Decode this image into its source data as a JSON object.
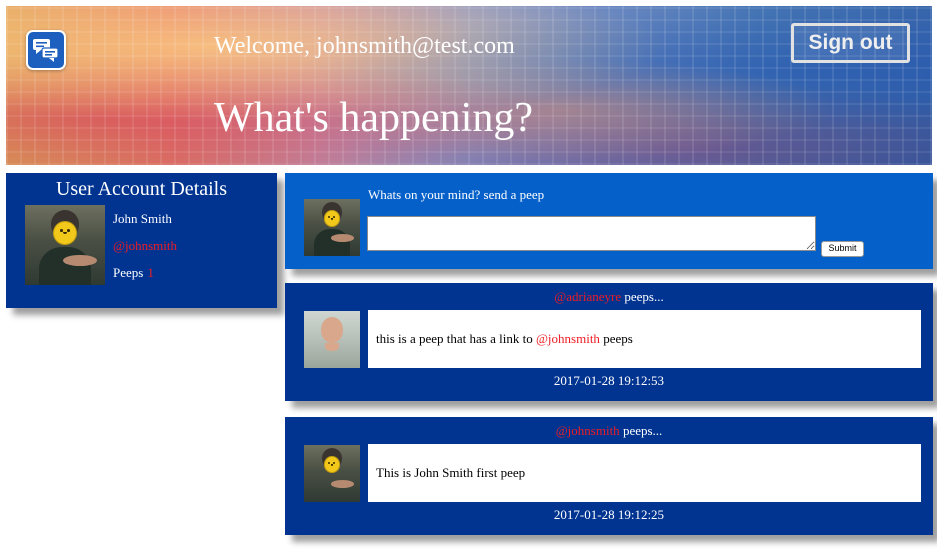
{
  "header": {
    "welcome": "Welcome, johnsmith@test.com",
    "headline": "What's happening?",
    "signout_label": "Sign out",
    "logo_icon": "chat-bubbles-icon"
  },
  "account": {
    "title": "User Account Details",
    "name": "John Smith",
    "handle": "@johnsmith",
    "peeps_label": "Peeps",
    "peeps_count": "1"
  },
  "compose": {
    "prompt": "Whats on your mind? send a peep",
    "textarea_value": "",
    "submit_label": "Submit"
  },
  "peeps": [
    {
      "author": "@adrianeyre",
      "suffix": " peeps...",
      "text_before": "this is a peep that has a link to ",
      "mention": "@johnsmith",
      "text_after": " peeps",
      "timestamp": "2017-01-28 19:12:53"
    },
    {
      "author": "@johnsmith",
      "suffix": " peeps...",
      "text_before": "This is John Smith first peep",
      "mention": "",
      "text_after": "",
      "timestamp": "2017-01-28 19:12:25"
    }
  ],
  "colors": {
    "panel_dark_blue": "#013491",
    "panel_bright_blue": "#0561c9",
    "handle_red": "#ee1c25"
  }
}
